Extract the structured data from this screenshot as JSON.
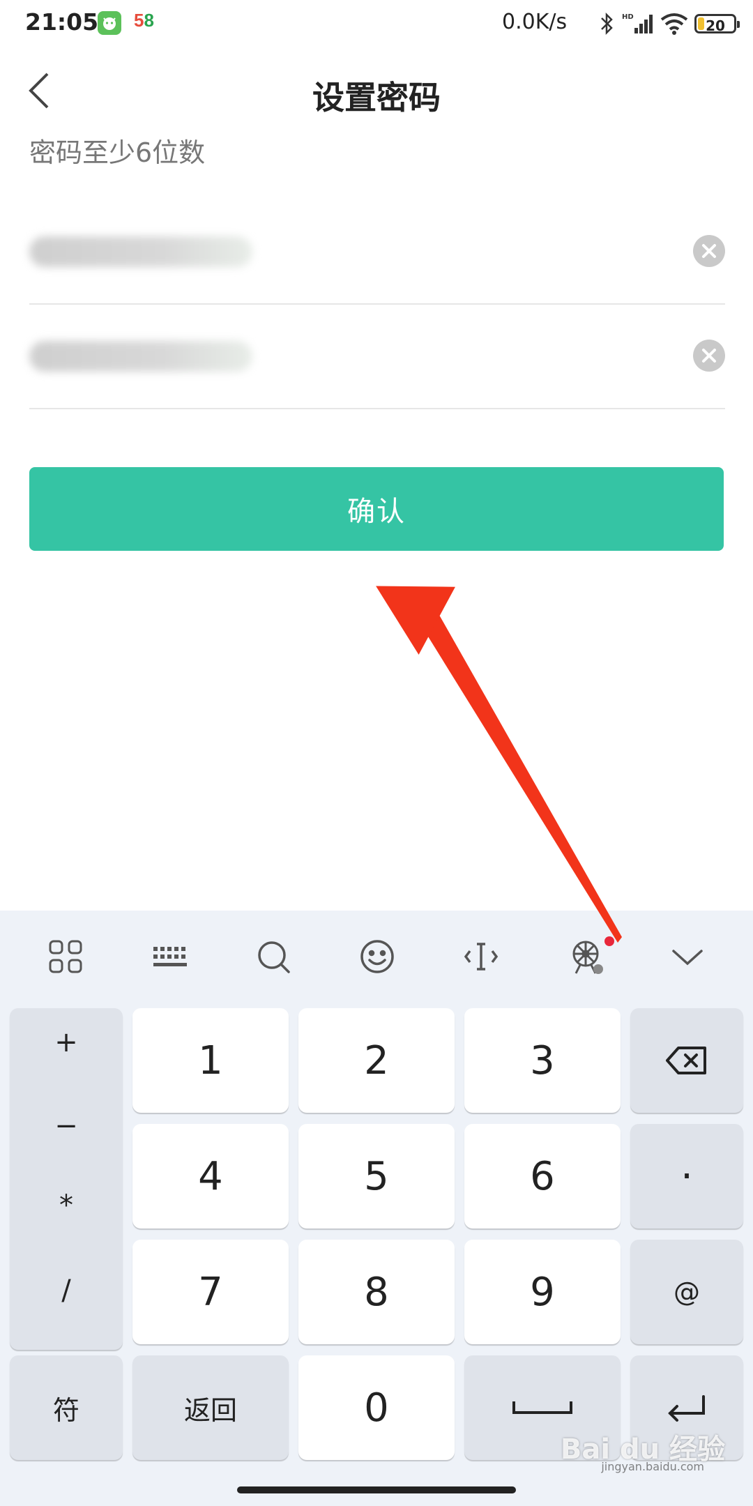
{
  "status_bar": {
    "time": "21:05",
    "app2_a": "5",
    "app2_b": "8",
    "net_speed": "0.0K/s",
    "battery": "20"
  },
  "header": {
    "title": "设置密码",
    "hint": "密码至少6位数"
  },
  "form": {
    "confirm_label": "确认"
  },
  "keyboard": {
    "symbols": [
      "+",
      "−",
      "*",
      "/"
    ],
    "rows": [
      [
        "1",
        "2",
        "3"
      ],
      [
        "4",
        "5",
        "6"
      ],
      [
        "7",
        "8",
        "9"
      ]
    ],
    "right_col": [
      "·",
      "@"
    ],
    "bottom": {
      "fu": "符",
      "back": "返回",
      "zero": "0"
    }
  },
  "watermark": {
    "text": "Bai du 经验",
    "sub": "jingyan.baidu.com"
  },
  "colors": {
    "accent": "#35c4a4",
    "annotation_arrow": "#f2341a"
  }
}
